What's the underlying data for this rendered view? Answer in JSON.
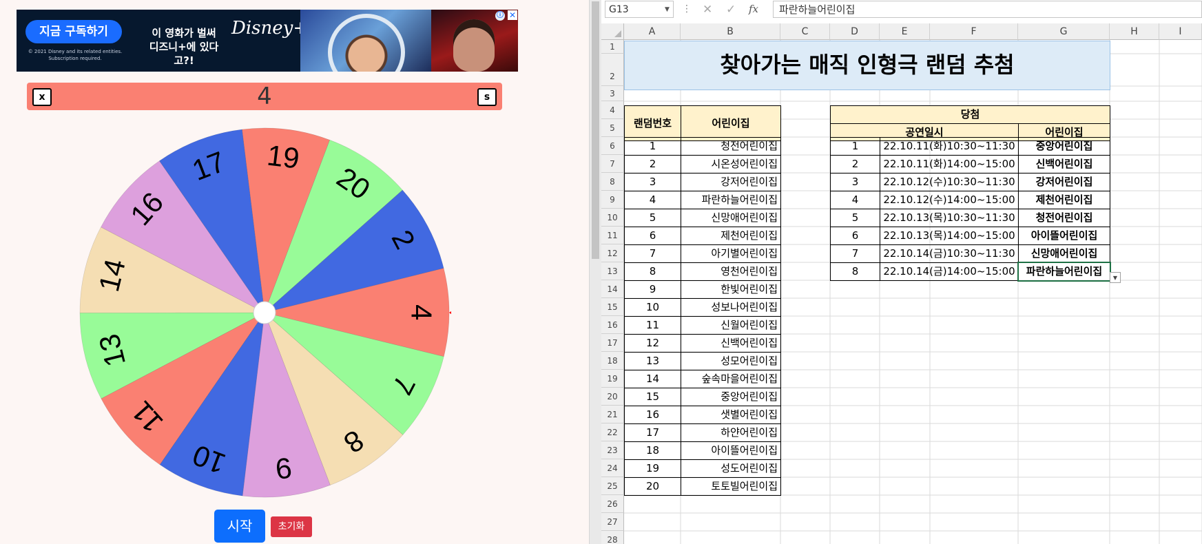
{
  "ad": {
    "cta_label": "지금 구독하기",
    "legal": "© 2021 Disney and its related entities. Subscription required.",
    "headline_line1": "이 영화가 벌써",
    "headline_line2": "디즈니+에 있다고?!",
    "brand": "Disney+",
    "info_icon": "ⓘ",
    "close_icon": "✕"
  },
  "wheel": {
    "current_result": "4",
    "close_label": "x",
    "settings_label": "s",
    "start_label": "시작",
    "reset_label": "초기화",
    "segments": [
      {
        "label": "19",
        "color": "#fa8072"
      },
      {
        "label": "20",
        "color": "#98fb98"
      },
      {
        "label": "2",
        "color": "#4169e1"
      },
      {
        "label": "4",
        "color": "#fa8072"
      },
      {
        "label": "7",
        "color": "#98fb98"
      },
      {
        "label": "8",
        "color": "#f5deb3"
      },
      {
        "label": "9",
        "color": "#dda0dd"
      },
      {
        "label": "10",
        "color": "#4169e1"
      },
      {
        "label": "11",
        "color": "#fa8072"
      },
      {
        "label": "13",
        "color": "#98fb98"
      },
      {
        "label": "14",
        "color": "#f5deb3"
      },
      {
        "label": "16",
        "color": "#dda0dd"
      },
      {
        "label": "17",
        "color": "#4169e1"
      }
    ],
    "pointer_color": "#ff0000"
  },
  "excel": {
    "name_box": "G13",
    "formula": "파란하늘어린이집",
    "columns": [
      "A",
      "B",
      "C",
      "D",
      "E",
      "F",
      "G",
      "H",
      "I"
    ],
    "rows": [
      "1",
      "2",
      "3",
      "4",
      "5",
      "6",
      "7",
      "8",
      "9",
      "10",
      "11",
      "12",
      "13",
      "14",
      "15",
      "16",
      "17",
      "18",
      "19",
      "20",
      "21",
      "22",
      "23",
      "24",
      "25",
      "26",
      "27",
      "28"
    ],
    "title": "찾아가는 매직 인형극 랜덤 추첨",
    "random_table": {
      "col1": "랜덤번호",
      "col2": "어린이집",
      "rows": [
        [
          "1",
          "청전어린이집"
        ],
        [
          "2",
          "시온성어린이집"
        ],
        [
          "3",
          "강저어린이집"
        ],
        [
          "4",
          "파란하늘어린이집"
        ],
        [
          "5",
          "신망애어린이집"
        ],
        [
          "6",
          "제천어린이집"
        ],
        [
          "7",
          "아기별어린이집"
        ],
        [
          "8",
          "영천어린이집"
        ],
        [
          "9",
          "한빛어린이집"
        ],
        [
          "10",
          "성보나어린이집"
        ],
        [
          "11",
          "신월어린이집"
        ],
        [
          "12",
          "신백어린이집"
        ],
        [
          "13",
          "성모어린이집"
        ],
        [
          "14",
          "숲속마을어린이집"
        ],
        [
          "15",
          "중앙어린이집"
        ],
        [
          "16",
          "샛별어린이집"
        ],
        [
          "17",
          "하얀어린이집"
        ],
        [
          "18",
          "아이뜰어린이집"
        ],
        [
          "19",
          "성도어린이집"
        ],
        [
          "20",
          "토토빌어린이집"
        ]
      ]
    },
    "winner_table": {
      "title": "당첨",
      "col1": "공연일시",
      "col2": "어린이집",
      "rows": [
        [
          "1",
          "22.10.11(화)10:30~11:30",
          "중앙어린이집"
        ],
        [
          "2",
          "22.10.11(화)14:00~15:00",
          "신백어린이집"
        ],
        [
          "3",
          "22.10.12(수)10:30~11:30",
          "강저어린이집"
        ],
        [
          "4",
          "22.10.12(수)14:00~15:00",
          "제천어린이집"
        ],
        [
          "5",
          "22.10.13(목)10:30~11:30",
          "청전어린이집"
        ],
        [
          "6",
          "22.10.13(목)14:00~15:00",
          "아이뜰어린이집"
        ],
        [
          "7",
          "22.10.14(금)10:30~11:30",
          "신망애어린이집"
        ],
        [
          "8",
          "22.10.14(금)14:00~15:00",
          "파란하늘어린이집"
        ]
      ]
    }
  }
}
